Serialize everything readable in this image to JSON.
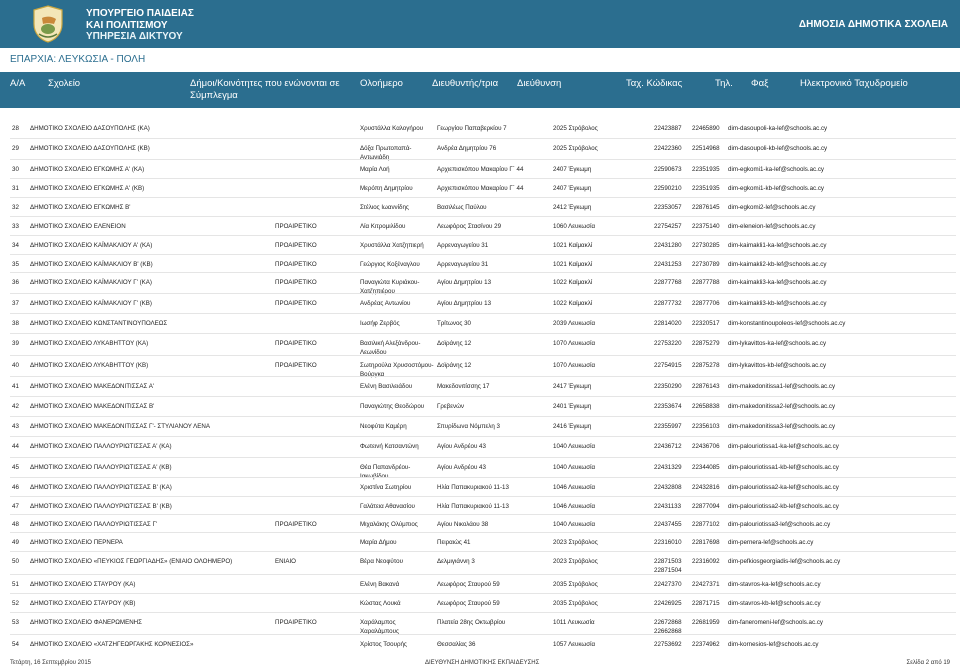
{
  "header": {
    "ministry_line1": "ΥΠΟΥΡΓΕΙΟ ΠΑΙΔΕΙΑΣ",
    "ministry_line2": "ΚΑΙ ΠΟΛΙΤΙΣΜΟΥ",
    "service": "ΥΠΗΡΕΣΙΑ ΔΙΚΤΥΟΥ",
    "title": "ΔΗΜΟΣΙΑ ΔΗΜΟΤΙΚΑ ΣΧΟΛΕΙΑ"
  },
  "eparchy": "ΕΠΑΡΧΙΑ: ΛΕΥΚΩΣΙΑ - ΠΟΛΗ",
  "columns": {
    "aa": "Α/Α",
    "school": "Σχολείο",
    "municipality": "Δήμοι/Κοινότητες που ενώνονται σε Σύμπλεγμα",
    "full_day": "Ολοήμερο",
    "principal": "Διευθυντής/τρια",
    "address": "Διεύθυνση",
    "postcode": "Ταχ. Κώδικας",
    "phone": "Τηλ.",
    "fax": "Φαξ",
    "email": "Ηλεκτρονικό Ταχυδρομείο"
  },
  "rows": [
    {
      "aa": "28",
      "school": "ΔΗΜΟΤΙΚΟ ΣΧΟΛΕΙΟ ΔΑΣΟΥΠΟΛΗΣ (ΚΑ)",
      "full_day": "",
      "principal": "Χρυστάλλα Καλογήρου",
      "address": "Γεωργίου Παπαβερκίου 7",
      "postcode": "2025 Στρόβολος",
      "phone": "22423887",
      "fax": "22465890",
      "email": "dim-dasoupoli-ka-lef@schools.ac.cy"
    },
    {
      "aa": "29",
      "school": "ΔΗΜΟΤΙΚΟ ΣΧΟΛΕΙΟ ΔΑΣΟΥΠΟΛΗΣ (ΚΒ)",
      "full_day": "",
      "principal": "Δόξα Πρωτοπαπά-Αντωνιάδη",
      "address": "Ανδρέα Δημητρίου 76",
      "postcode": "2025 Στρόβολος",
      "phone": "22422360",
      "fax": "22514968",
      "email": "dim-dasoupoli-kb-lef@schools.ac.cy"
    },
    {
      "aa": "30",
      "school": "ΔΗΜΟΤΙΚΟ ΣΧΟΛΕΙΟ ΕΓΚΩΜΗΣ Α' (ΚΑ)",
      "full_day": "",
      "principal": "Μαρία Λοή",
      "address": "Αρχιεπισκόπου Μακαρίου Γ΄ 44",
      "postcode": "2407 Έγκωμη",
      "phone": "22590673",
      "fax": "22351935",
      "email": "dim-egkomi1-ka-lef@schools.ac.cy"
    },
    {
      "aa": "31",
      "school": "ΔΗΜΟΤΙΚΟ ΣΧΟΛΕΙΟ ΕΓΚΩΜΗΣ Α' (ΚΒ)",
      "full_day": "",
      "principal": "Μερόπη Δημητρίου",
      "address": "Αρχιεπισκόπου Μακαρίου Γ΄ 44",
      "postcode": "2407 Έγκωμη",
      "phone": "22590210",
      "fax": "22351935",
      "email": "dim-egkomi1-kb-lef@schools.ac.cy"
    },
    {
      "aa": "32",
      "school": "ΔΗΜΟΤΙΚΟ ΣΧΟΛΕΙΟ ΕΓΚΩΜΗΣ Β'",
      "full_day": "",
      "principal": "Στέλιος Ιωαννίδης",
      "address": "Βασιλέως Παύλου",
      "postcode": "2412 Έγκωμη",
      "phone": "22353057",
      "fax": "22876145",
      "email": "dim-egkomi2-lef@schools.ac.cy"
    },
    {
      "aa": "33",
      "school": "ΔΗΜΟΤΙΚΟ ΣΧΟΛΕΙΟ ΕΛΕΝΕΙΟΝ",
      "full_day": "ΠΡΟΑΙΡΕΤΙΚΟ",
      "principal": "Λία Κιτρομιλίδου",
      "address": "Λεωφόρος Στασίνου 29",
      "postcode": "1060 Λευκωσία",
      "phone": "22754257",
      "fax": "22375140",
      "email": "dim-eleneion-lef@schools.ac.cy"
    },
    {
      "aa": "34",
      "school": "ΔΗΜΟΤΙΚΟ ΣΧΟΛΕΙΟ ΚΑΪΜΑΚΛΙΟΥ Α' (ΚΑ)",
      "full_day": "ΠΡΟΑΙΡΕΤΙΚΟ",
      "principal": "Χρυστάλλα Χατζηπιερή",
      "address": "Αρρεναγωγείου 31",
      "postcode": "1021 Καϊμακλί",
      "phone": "22431280",
      "fax": "22730285",
      "email": "dim-kaimakli1-ka-lef@schools.ac.cy"
    },
    {
      "aa": "35",
      "school": "ΔΗΜΟΤΙΚΟ ΣΧΟΛΕΙΟ ΚΑΪΜΑΚΛΙΟΥ Β' (ΚΒ)",
      "full_day": "ΠΡΟΑΙΡΕΤΙΚΟ",
      "principal": "Γεώργιος Κοξέναγλου",
      "address": "Αρρεναγωγείου 31",
      "postcode": "1021 Καϊμακλί",
      "phone": "22431253",
      "fax": "22730789",
      "email": "dim-kaimakli2-kb-lef@schools.ac.cy"
    },
    {
      "aa": "36",
      "school": "ΔΗΜΟΤΙΚΟ ΣΧΟΛΕΙΟ ΚΑΪΜΑΚΛΙΟΥ Γ' (ΚΑ)",
      "full_day": "ΠΡΟΑΙΡΕΤΙΚΟ",
      "principal": "Παναγιώτα Κυριάκου-Χατζηπιέρου",
      "address": "Αγίου Δημητρίου 13",
      "postcode": "1022 Καϊμακλί",
      "phone": "22877768",
      "fax": "22877788",
      "email": "dim-kaimakli3-ka-lef@schools.ac.cy"
    },
    {
      "aa": "37",
      "school": "ΔΗΜΟΤΙΚΟ ΣΧΟΛΕΙΟ ΚΑΪΜΑΚΛΙΟΥ Γ' (ΚΒ)",
      "full_day": "ΠΡΟΑΙΡΕΤΙΚΟ",
      "principal": "Ανδρέας Αντωνίου",
      "address": "Αγίου Δημητρίου 13",
      "postcode": "1022 Καϊμακλί",
      "phone": "22877732",
      "fax": "22877706",
      "email": "dim-kaimakli3-kb-lef@schools.ac.cy"
    },
    {
      "aa": "38",
      "school": "ΔΗΜΟΤΙΚΟ ΣΧΟΛΕΙΟ ΚΩΝΣΤΑΝΤΙΝΟΥΠΟΛΕΩΣ",
      "full_day": "",
      "principal": "Ιωσήφ Ζερβός",
      "address": "Τρίτωνος 30",
      "postcode": "2039 Λευκωσία",
      "phone": "22814020",
      "fax": "22320517",
      "email": "dim-konstantinoupoleos-lef@schools.ac.cy"
    },
    {
      "aa": "39",
      "school": "ΔΗΜΟΤΙΚΟ ΣΧΟΛΕΙΟ ΛΥΚΑΒΗΤΤΟΥ (ΚΑ)",
      "full_day": "ΠΡΟΑΙΡΕΤΙΚΟ",
      "principal": "Βασιλική Αλεξάνδρου-Λεωνίδου",
      "address": "Δοϊράνης 12",
      "postcode": "1070 Λευκωσία",
      "phone": "22753220",
      "fax": "22875279",
      "email": "dim-lykavittos-ka-lef@schools.ac.cy"
    },
    {
      "aa": "40",
      "school": "ΔΗΜΟΤΙΚΟ ΣΧΟΛΕΙΟ ΛΥΚΑΒΗΤΤΟΥ (ΚΒ)",
      "full_day": "ΠΡΟΑΙΡΕΤΙΚΟ",
      "principal": "Σωτηρούλα Χρυσοστόμου-Βούργκα",
      "address": "Δοϊράνης 12",
      "postcode": "1070 Λευκωσία",
      "phone": "22754915",
      "fax": "22875278",
      "email": "dim-lykavittos-kb-lef@schools.ac.cy"
    },
    {
      "aa": "41",
      "school": "ΔΗΜΟΤΙΚΟ ΣΧΟΛΕΙΟ ΜΑΚΕΔΟΝΙΤΙΣΣΑΣ Α'",
      "full_day": "",
      "principal": "Ελένη Βασιλειάδου",
      "address": "Μακεδονιτίσσης 17",
      "postcode": "2417 Έγκωμη",
      "phone": "22350290",
      "fax": "22876143",
      "email": "dim-makedonitissa1-lef@schools.ac.cy"
    },
    {
      "aa": "42",
      "school": "ΔΗΜΟΤΙΚΟ ΣΧΟΛΕΙΟ ΜΑΚΕΔΟΝΙΤΙΣΣΑΣ Β'",
      "full_day": "",
      "principal": "Παναγιώτης Θεοδώρου",
      "address": "Γρεβενών",
      "postcode": "2401 Έγκωμη",
      "phone": "22353674",
      "fax": "22658838",
      "email": "dim-makedonitissa2-lef@schools.ac.cy"
    },
    {
      "aa": "43",
      "school": "ΔΗΜΟΤΙΚΟ ΣΧΟΛΕΙΟ ΜΑΚΕΔΟΝΙΤΙΣΣΑΣ Γ'- ΣΤΥΛΙΑΝΟΥ ΛΕΝΑ",
      "full_day": "",
      "principal": "Νεοφύτα Καμέρη",
      "address": "Σπυρίδωνα Νόμπελη 3",
      "postcode": "2416 Έγκωμη",
      "phone": "22355997",
      "fax": "22356103",
      "email": "dim-makedonitissa3-lef@schools.ac.cy"
    },
    {
      "aa": "44",
      "school": "ΔΗΜΟΤΙΚΟ ΣΧΟΛΕΙΟ ΠΑΛΛΟΥΡΙΩΤΙΣΣΑΣ Α' (ΚΑ)",
      "full_day": "",
      "principal": "Φωτεινή Κατσαντώνη",
      "address": "Αγίου Ανδρέου 43",
      "postcode": "1040 Λευκωσία",
      "phone": "22436712",
      "fax": "22436706",
      "email": "dim-palouriotissa1-ka-lef@schools.ac.cy"
    },
    {
      "aa": "45",
      "school": "ΔΗΜΟΤΙΚΟ ΣΧΟΛΕΙΟ ΠΑΛΛΟΥΡΙΩΤΙΣΣΑΣ Α' (ΚΒ)",
      "full_day": "",
      "principal": "Θέα Παπανδρέου-Ιακωβίδου",
      "address": "Αγίου Ανδρέου 43",
      "postcode": "1040 Λευκωσία",
      "phone": "22431329",
      "fax": "22344085",
      "email": "dim-palouriotissa1-kb-lef@schools.ac.cy"
    },
    {
      "aa": "46",
      "school": "ΔΗΜΟΤΙΚΟ ΣΧΟΛΕΙΟ ΠΑΛΛΟΥΡΙΩΤΙΣΣΑΣ Β' (ΚΑ)",
      "full_day": "",
      "principal": "Χριστίνα Σωτηρίου",
      "address": "Ηλία Παπακυριακού 11-13",
      "postcode": "1046 Λευκωσία",
      "phone": "22432808",
      "fax": "22432816",
      "email": "dim-palouriotissa2-ka-lef@schools.ac.cy"
    },
    {
      "aa": "47",
      "school": "ΔΗΜΟΤΙΚΟ ΣΧΟΛΕΙΟ ΠΑΛΛΟΥΡΙΩΤΙΣΣΑΣ Β' (ΚΒ)",
      "full_day": "",
      "principal": "Γαλάτεια Αθανασίου",
      "address": "Ηλία Παπακυριακού 11-13",
      "postcode": "1046 Λευκωσία",
      "phone": "22431133",
      "fax": "22877094",
      "email": "dim-palouriotissa2-kb-lef@schools.ac.cy"
    },
    {
      "aa": "48",
      "school": "ΔΗΜΟΤΙΚΟ ΣΧΟΛΕΙΟ ΠΑΛΛΟΥΡΙΩΤΙΣΣΑΣ Γ'",
      "full_day": "ΠΡΟΑΙΡΕΤΙΚΟ",
      "principal": "Μιχαλάκης Ολύμπιος",
      "address": "Αγίου Νικολάου 38",
      "postcode": "1040 Λευκωσία",
      "phone": "22437455",
      "fax": "22877102",
      "email": "dim-palouriotissa3-lef@schools.ac.cy"
    },
    {
      "aa": "49",
      "school": "ΔΗΜΟΤΙΚΟ ΣΧΟΛΕΙΟ ΠΕΡΝΕΡΑ",
      "full_day": "",
      "principal": "Μαρία Δήμου",
      "address": "Πειραιώς 41",
      "postcode": "2023 Στρόβολος",
      "phone": "22316010",
      "fax": "22817698",
      "email": "dim-pernera-lef@schools.ac.cy"
    },
    {
      "aa": "50",
      "school": "ΔΗΜΟΤΙΚΟ ΣΧΟΛΕΙΟ «ΠΕΥΚΙΟΣ ΓΕΩΡΓΙΑΔΗΣ» (ΕΝΙΑΙΟ ΟΛΟΗΜΕΡΟ)",
      "full_day": "ΕΝΙΑΙΟ",
      "principal": "Βέρα Νεοφύτου",
      "address": "Δελμιγιάννη 3",
      "postcode": "2023 Στρόβολος",
      "phone": "22871503 22871504",
      "fax": "22316092",
      "email": "dim-pefkiosgeorgiadis-lef@schools.ac.cy"
    },
    {
      "aa": "51",
      "school": "ΔΗΜΟΤΙΚΟ ΣΧΟΛΕΙΟ ΣΤΑΥΡΟΥ (ΚΑ)",
      "full_day": "",
      "principal": "Ελένη Βακανά",
      "address": "Λεωφόρος Σταυρού 59",
      "postcode": "2035 Στρόβολος",
      "phone": "22427370",
      "fax": "22427371",
      "email": "dim-stavros-ka-lef@schools.ac.cy"
    },
    {
      "aa": "52",
      "school": "ΔΗΜΟΤΙΚΟ ΣΧΟΛΕΙΟ ΣΤΑΥΡΟΥ (ΚΒ)",
      "full_day": "",
      "principal": "Κώστας Λουκά",
      "address": "Λεωφόρος Σταυρού 59",
      "postcode": "2035 Στρόβολος",
      "phone": "22426925",
      "fax": "22871715",
      "email": "dim-stavros-kb-lef@schools.ac.cy"
    },
    {
      "aa": "53",
      "school": "ΔΗΜΟΤΙΚΟ ΣΧΟΛΕΙΟ ΦΑΝΕΡΩΜΕΝΗΣ",
      "full_day": "ΠΡΟΑΙΡΕΤΙΚΟ",
      "principal": "Χαράλαμπος Χαραλάμπους",
      "address": "Πλατεία 28ης Οκτωβρίου",
      "postcode": "1011 Λευκωσία",
      "phone": "22672868 22662868",
      "fax": "22681959",
      "email": "dim-faneromeni-lef@schools.ac.cy"
    },
    {
      "aa": "54",
      "school": "ΔΗΜΟΤΙΚΟ ΣΧΟΛΕΙΟ «ΧΑΤΖΗΓΕΩΡΓΑΚΗΣ ΚΟΡΝΕΣΙΟΣ»",
      "full_day": "",
      "principal": "Χρίστος Τσουρής",
      "address": "Θεσσαλίας 36",
      "postcode": "1057 Λευκωσία",
      "phone": "22753692",
      "fax": "22374962",
      "email": "dim-kornesios-lef@schools.ac.cy"
    }
  ],
  "footer": {
    "date": "Τετάρτη, 16 Σεπτεμβρίου 2015",
    "department": "ΔΙΕΥΘΥΝΣΗ ΔΗΜΟΤΙΚΗΣ ΕΚΠΑΙΔΕΥΣΗΣ",
    "page": "Σελίδα 2 από 19"
  }
}
